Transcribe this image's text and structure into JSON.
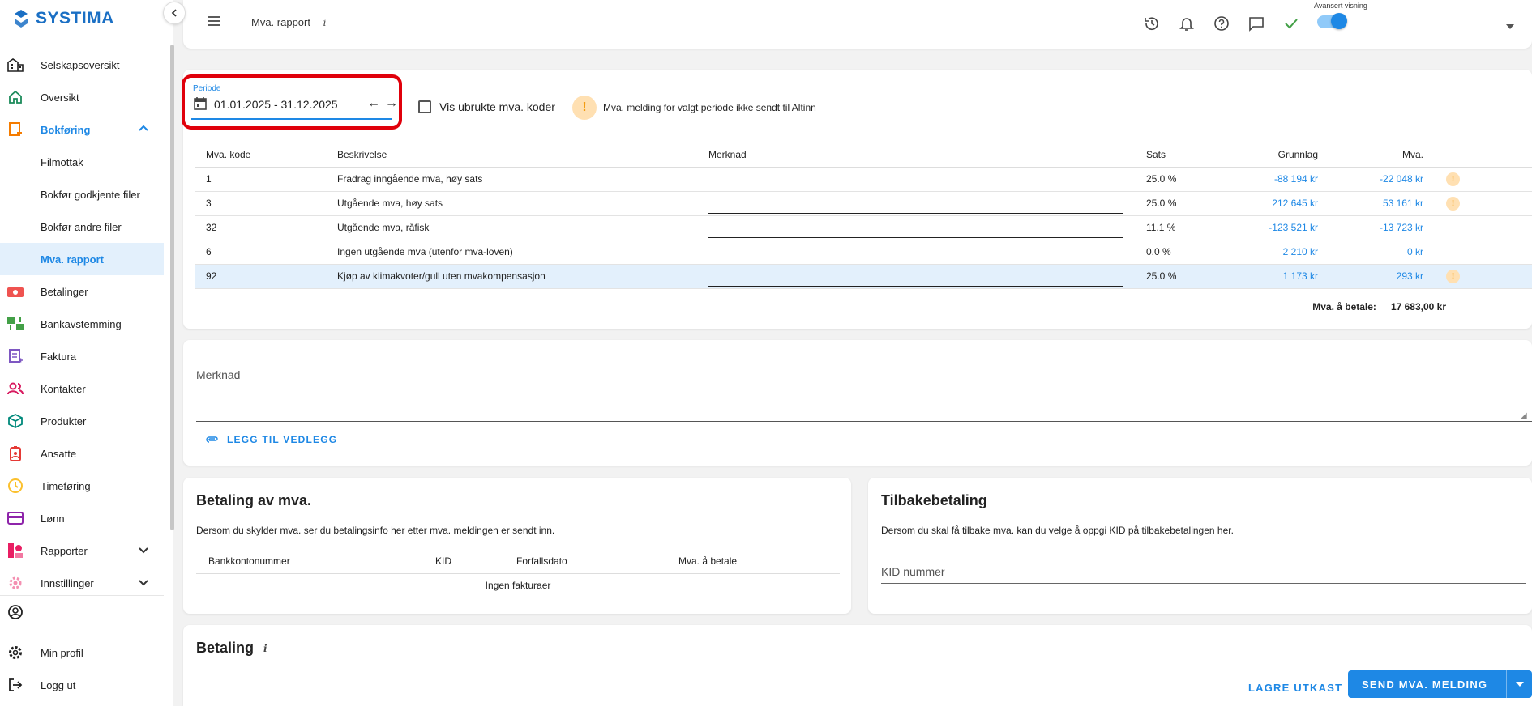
{
  "app": {
    "name": "SYSTIMA"
  },
  "sidebar": {
    "items": [
      {
        "label": "Selskapsoversikt",
        "icon": "company-icon"
      },
      {
        "label": "Oversikt",
        "icon": "home-icon"
      },
      {
        "label": "Bokføring",
        "icon": "bookkeeping-icon"
      },
      {
        "label": "Filmottak"
      },
      {
        "label": "Bokfør godkjente filer"
      },
      {
        "label": "Bokfør andre filer"
      },
      {
        "label": "Mva. rapport"
      },
      {
        "label": "Betalinger",
        "icon": "payments-icon"
      },
      {
        "label": "Bankavstemming",
        "icon": "bank-reconciliation-icon"
      },
      {
        "label": "Faktura",
        "icon": "invoice-icon"
      },
      {
        "label": "Kontakter",
        "icon": "contacts-icon"
      },
      {
        "label": "Produkter",
        "icon": "products-icon"
      },
      {
        "label": "Ansatte",
        "icon": "employees-icon"
      },
      {
        "label": "Timeføring",
        "icon": "clock-icon"
      },
      {
        "label": "Lønn",
        "icon": "salary-icon"
      },
      {
        "label": "Rapporter",
        "icon": "reports-icon"
      },
      {
        "label": "Innstillinger",
        "icon": "settings-icon"
      }
    ],
    "bottom": [
      {
        "label": "Min profil",
        "icon": "gear-icon"
      },
      {
        "label": "Logg ut",
        "icon": "logout-icon"
      }
    ]
  },
  "topbar": {
    "title": "Mva. rapport",
    "info": "i",
    "advanced_label": "Avansert visning",
    "advanced_on": true
  },
  "filters": {
    "period_label": "Periode",
    "period_value": "01.01.2025 - 31.12.2025",
    "show_unused_label": "Vis ubrukte mva. koder",
    "show_unused_checked": false,
    "warning_text": "Mva. melding for valgt periode ikke sendt til Altinn"
  },
  "mva_table": {
    "headers": [
      "Mva. kode",
      "Beskrivelse",
      "Merknad",
      "Sats",
      "Grunnlag",
      "Mva."
    ],
    "rows": [
      {
        "kode": "1",
        "beskrivelse": "Fradrag inngående mva, høy sats",
        "sats": "25.0 %",
        "grunnlag": "-88 194 kr",
        "mva": "-22 048 kr",
        "warn": true
      },
      {
        "kode": "3",
        "beskrivelse": "Utgående mva, høy sats",
        "sats": "25.0 %",
        "grunnlag": "212 645 kr",
        "mva": "53 161 kr",
        "warn": true
      },
      {
        "kode": "32",
        "beskrivelse": "Utgående mva, råfisk",
        "sats": "11.1 %",
        "grunnlag": "-123 521 kr",
        "mva": "-13 723 kr",
        "warn": false
      },
      {
        "kode": "6",
        "beskrivelse": "Ingen utgående mva (utenfor mva-loven)",
        "sats": "0.0 %",
        "grunnlag": "2 210 kr",
        "mva": "0 kr",
        "warn": false
      },
      {
        "kode": "92",
        "beskrivelse": "Kjøp av klimakvoter/gull uten mvakompensasjon",
        "sats": "25.0 %",
        "grunnlag": "1 173 kr",
        "mva": "293 kr",
        "warn": true
      }
    ],
    "total_label": "Mva. å betale:",
    "total_value": "17 683,00 kr"
  },
  "note": {
    "label": "Merknad",
    "attach_label": "LEGG TIL VEDLEGG"
  },
  "betaling_mva": {
    "title": "Betaling av mva.",
    "description": "Dersom du skylder mva. ser du betalingsinfo her etter mva. meldingen er sendt inn.",
    "headers": [
      "Bankkontonummer",
      "KID",
      "Forfallsdato",
      "Mva. å betale"
    ],
    "empty_text": "Ingen fakturaer"
  },
  "tilbakebetaling": {
    "title": "Tilbakebetaling",
    "description": "Dersom du skal få tilbake mva. kan du velge å oppgi KID på tilbakebetalingen her.",
    "kid_placeholder": "KID nummer"
  },
  "betaling": {
    "title": "Betaling",
    "info": "i",
    "save_draft_label": "LAGRE UTKAST",
    "send_label": "SEND MVA. MELDING"
  },
  "colors": {
    "accent": "#1e88e5",
    "highlight_outline": "#e0000b",
    "warning": "#f39c12"
  }
}
